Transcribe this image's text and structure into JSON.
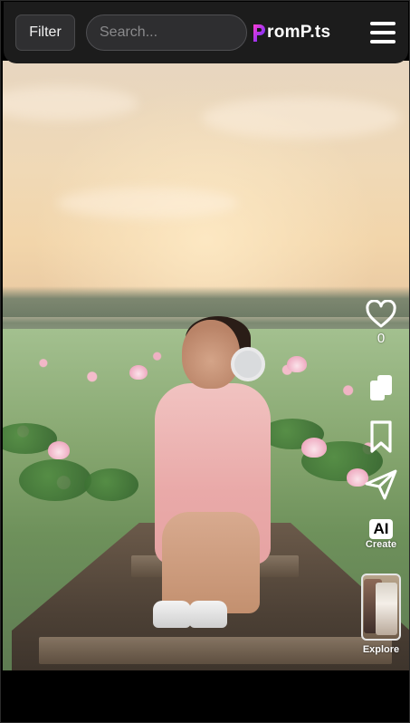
{
  "header": {
    "filter_label": "Filter",
    "search_placeholder": "Search...",
    "logo_text": "romP.ts",
    "logo_color": "#7b2ff7"
  },
  "rail": {
    "like_count": "0",
    "create_badge": "AI",
    "create_label": "Create",
    "explore_label": "Explore"
  },
  "icons": [
    "filter",
    "menu-icon",
    "heart-icon",
    "copy-icon",
    "bookmark-icon",
    "send-icon",
    "ai-create-icon"
  ]
}
